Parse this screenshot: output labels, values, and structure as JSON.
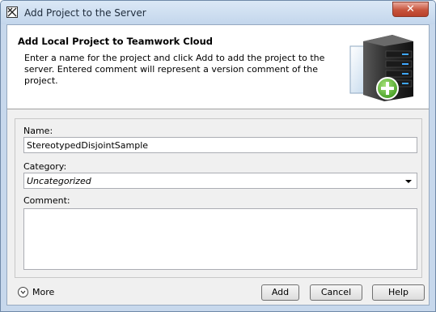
{
  "window": {
    "title": "Add Project to the Server",
    "close_symbol": "✕"
  },
  "header": {
    "title": "Add Local Project to Teamwork Cloud",
    "description": "Enter a name for the project and click Add to add the project to the server. Entered comment will represent a version comment of the project.",
    "art_icon": "server-add-icon"
  },
  "form": {
    "name_label": "Name:",
    "name_value": "StereotypedDisjointSample",
    "category_label": "Category:",
    "category_value": "Uncategorized",
    "comment_label": "Comment:",
    "comment_value": ""
  },
  "footer": {
    "more_label": "More",
    "add_label": "Add",
    "cancel_label": "Cancel",
    "help_label": "Help"
  },
  "colors": {
    "titlebar": "#c7d8ec",
    "close_button": "#c7543c",
    "plus_badge": "#5cb82e",
    "dialog_bg": "#f0f0f0"
  }
}
